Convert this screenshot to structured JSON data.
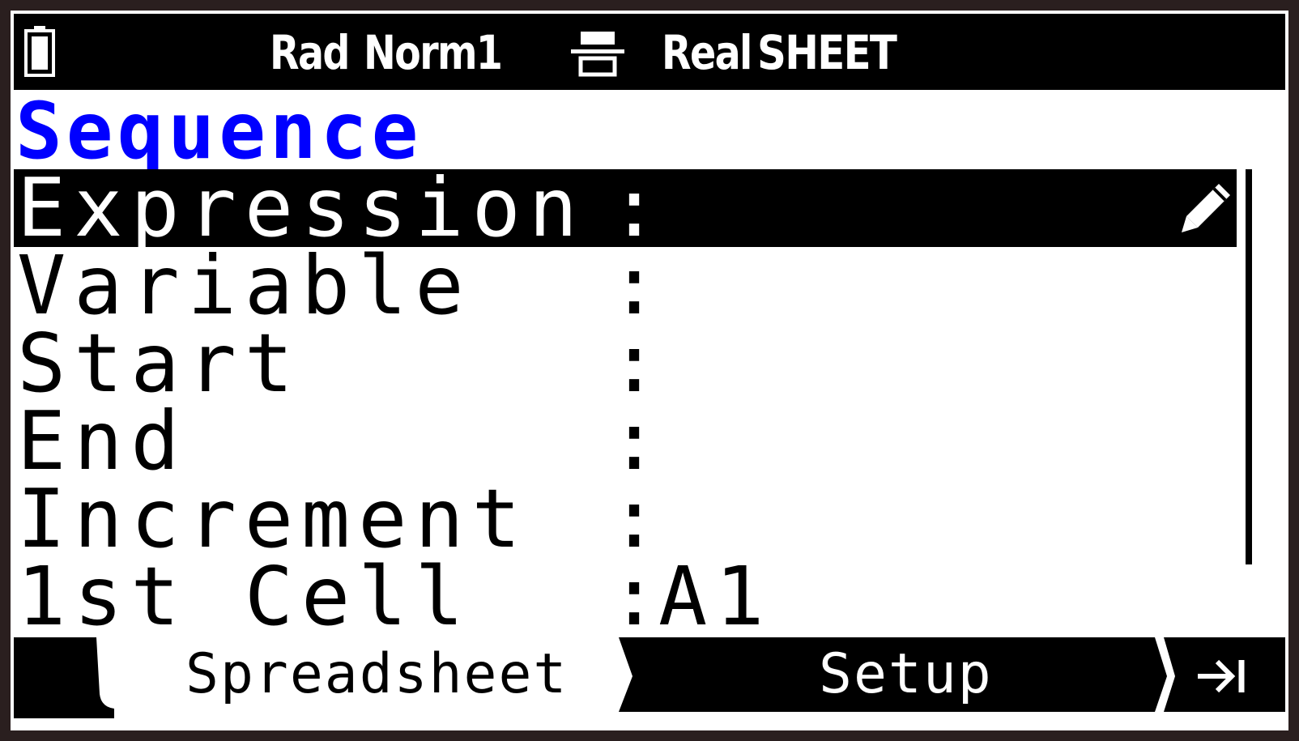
{
  "status_bar": {
    "angle_unit": "Rad",
    "display_format": "Norm1",
    "complex_mode": "Real",
    "mode": "SHEET",
    "battery_icon": "battery-icon",
    "input_icon": "math-input-icon"
  },
  "title": "Sequence",
  "fields": [
    {
      "label": "Expression",
      "colon": ":",
      "value": "",
      "selected": true
    },
    {
      "label": "Variable",
      "colon": ":",
      "value": ""
    },
    {
      "label": "Start",
      "colon": ":",
      "value": ""
    },
    {
      "label": "End",
      "colon": ":",
      "value": ""
    },
    {
      "label": "Increment",
      "colon": ":",
      "value": ""
    },
    {
      "label": "1st Cell",
      "colon": ":",
      "value": "A1"
    }
  ],
  "edit_icon": "pencil-icon",
  "menu": {
    "tabs": [
      {
        "label": "Spreadsheet",
        "active": true
      },
      {
        "label": "Setup",
        "active": false
      }
    ],
    "end_icon": "arrow-to-end-icon"
  },
  "colors": {
    "title": "#0000ff",
    "background": "#ffffff",
    "bar": "#000000",
    "bezel": "#2a1f1f"
  }
}
